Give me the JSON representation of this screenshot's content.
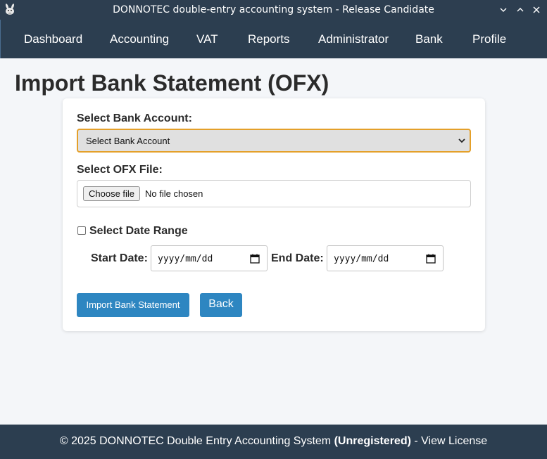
{
  "window": {
    "title": "DONNOTEC double-entry accounting system - Release Candidate",
    "icon": "donkey-app-icon",
    "controls": [
      "minimize",
      "maximize",
      "close"
    ]
  },
  "nav": {
    "items": [
      "Dashboard",
      "Accounting",
      "VAT",
      "Reports",
      "Administrator",
      "Bank",
      "Profile"
    ]
  },
  "page": {
    "title": "Import Bank Statement (OFX)"
  },
  "form": {
    "bank_account": {
      "label": "Select Bank Account:",
      "selected": "Select Bank Account"
    },
    "ofx_file": {
      "label": "Select OFX File:",
      "button": "Choose file",
      "status": "No file chosen"
    },
    "date_range": {
      "checkbox_label": "Select Date Range",
      "checked": false,
      "start_label": "Start Date:",
      "start_placeholder": "yyyy/mm/dd",
      "end_label": "End Date:",
      "end_placeholder": "yyyy/mm/dd"
    },
    "buttons": {
      "import": "Import Bank Statement",
      "back": "Back"
    }
  },
  "footer": {
    "prefix": "© 2025 DONNOTEC Double Entry Accounting System",
    "status": "(Unregistered)",
    "separator": " - ",
    "link": "View License"
  },
  "colors": {
    "titlebar": "#2d3e50",
    "nav": "#2c3e50",
    "accent_button": "#2e86c1",
    "focus_border": "#e4a02a",
    "page_bg": "#f4f6f9"
  }
}
